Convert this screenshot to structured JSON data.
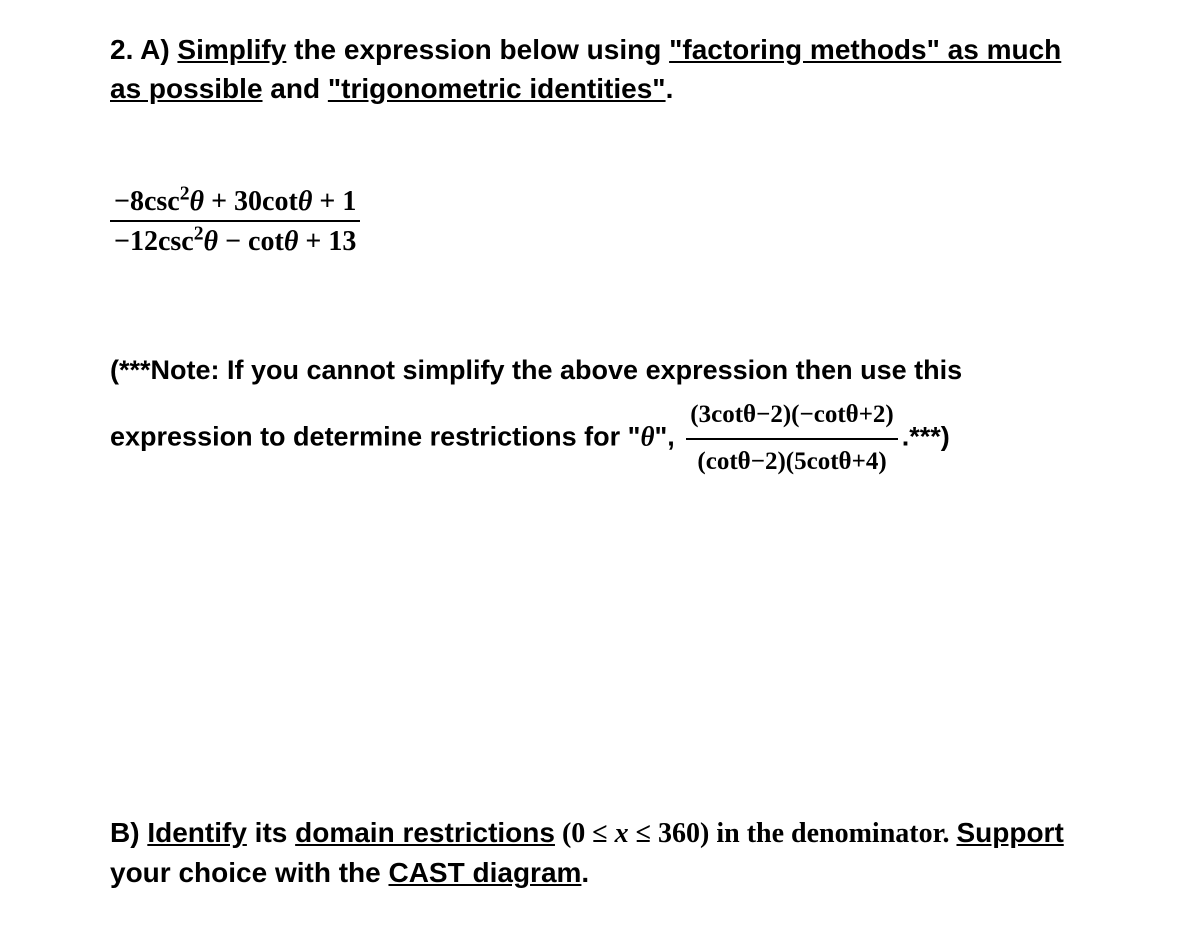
{
  "question": {
    "header_prefix": "2. A) ",
    "header_simplify": "Simplify",
    "header_mid1": " the expression below using ",
    "header_factoring": "\"factoring methods\" as much as possible",
    "header_mid2": " and ",
    "header_trig": "\"trigonometric identities\"",
    "header_period": "."
  },
  "fraction": {
    "numerator_prefix": "−8",
    "numerator_csc": "csc",
    "numerator_sq": "2",
    "numerator_theta": "θ",
    "numerator_mid": " + 30",
    "numerator_cot": "cot",
    "numerator_theta2": "θ",
    "numerator_end": " + 1",
    "denominator_prefix": "−12",
    "denominator_csc": "csc",
    "denominator_sq": "2",
    "denominator_theta": "θ",
    "denominator_mid": " − ",
    "denominator_cot": "cot",
    "denominator_theta2": "θ",
    "denominator_end": " + 13"
  },
  "note": {
    "prefix": "(***Note: If you cannot simplify the above expression then use this expression to determine restrictions for \"",
    "theta_quote": "θ",
    "mid": "\", ",
    "frac_num": "(3cotθ−2)(−cotθ+2)",
    "frac_den": "(cotθ−2)(5cotθ+4)",
    "suffix": ".***)"
  },
  "partb": {
    "prefix": "B) ",
    "identify": "Identify",
    "mid1": " its ",
    "domain": "domain restrictions",
    "range": " (0 ≤ ",
    "xvar": "x",
    "range2": " ≤ 360) in the denominator. ",
    "support": "Support",
    "mid2": " your choice with the ",
    "cast": "CAST diagram",
    "period": "."
  }
}
